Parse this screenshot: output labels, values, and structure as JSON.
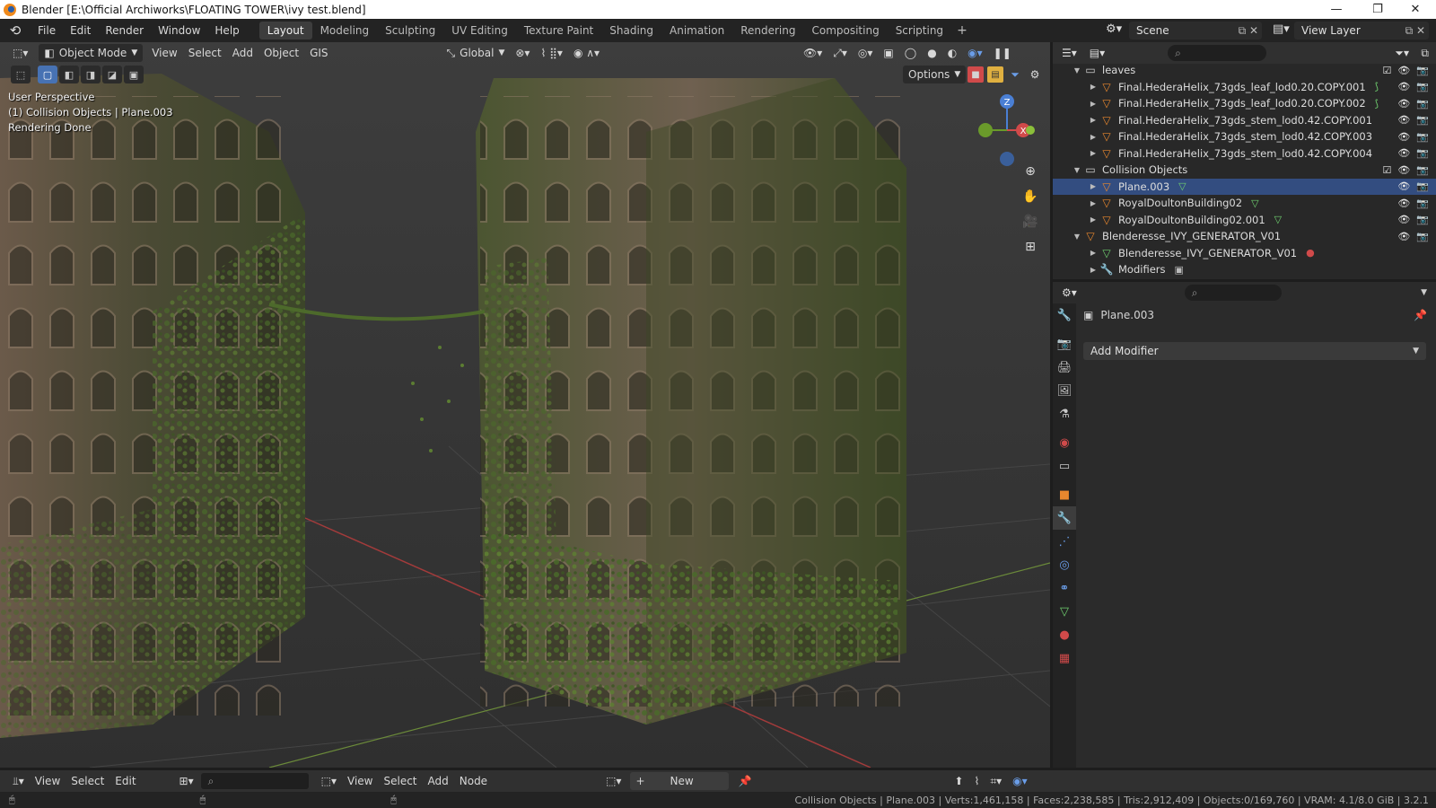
{
  "window": {
    "title": "Blender [E:\\Official Archiworks\\FLOATING TOWER\\ivy test.blend]",
    "controls": [
      "—",
      "❐",
      "✕"
    ]
  },
  "menus": [
    "File",
    "Edit",
    "Render",
    "Window",
    "Help"
  ],
  "workspaces": [
    {
      "label": "Layout",
      "active": true
    },
    {
      "label": "Modeling"
    },
    {
      "label": "Sculpting"
    },
    {
      "label": "UV Editing"
    },
    {
      "label": "Texture Paint"
    },
    {
      "label": "Shading"
    },
    {
      "label": "Animation"
    },
    {
      "label": "Rendering"
    },
    {
      "label": "Compositing"
    },
    {
      "label": "Scripting"
    }
  ],
  "scene": {
    "name": "Scene",
    "view_layer": "View Layer"
  },
  "viewport": {
    "mode": "Object Mode",
    "menus": [
      "View",
      "Select",
      "Add",
      "Object",
      "GIS"
    ],
    "transform_orientation": "Global",
    "options_label": "Options",
    "info_lines": [
      "User Perspective",
      "(1) Collision Objects | Plane.003",
      "Rendering Done"
    ],
    "gizmo_axes": {
      "z": "Z",
      "x": "X",
      "y": "Y"
    },
    "accent": "#4772b3"
  },
  "outliner": {
    "rows": [
      {
        "level": 0,
        "type": "collection",
        "label": "leaves",
        "expanded": true,
        "checkbox": true
      },
      {
        "level": 1,
        "type": "object",
        "label": "Final.HederaHelix_73gds_leaf_lod0.20.COPY.001",
        "tag": "curve"
      },
      {
        "level": 1,
        "type": "object",
        "label": "Final.HederaHelix_73gds_leaf_lod0.20.COPY.002",
        "tag": "curve"
      },
      {
        "level": 1,
        "type": "object",
        "label": "Final.HederaHelix_73gds_stem_lod0.42.COPY.001"
      },
      {
        "level": 1,
        "type": "object",
        "label": "Final.HederaHelix_73gds_stem_lod0.42.COPY.003"
      },
      {
        "level": 1,
        "type": "object",
        "label": "Final.HederaHelix_73gds_stem_lod0.42.COPY.004"
      },
      {
        "level": 0,
        "type": "collection",
        "label": "Collision Objects",
        "expanded": true,
        "checkbox": true
      },
      {
        "level": 1,
        "type": "object",
        "label": "Plane.003",
        "tag": "mesh"
      },
      {
        "level": 1,
        "type": "object",
        "label": "RoyalDoultonBuilding02",
        "tag": "mesh"
      },
      {
        "level": 1,
        "type": "object",
        "label": "RoyalDoultonBuilding02.001",
        "tag": "mesh"
      },
      {
        "level": 0,
        "type": "object",
        "label": "Blenderesse_IVY_GENERATOR_V01",
        "expanded": true
      },
      {
        "level": 1,
        "type": "mesh",
        "label": "Blenderesse_IVY_GENERATOR_V01",
        "tag": "material"
      },
      {
        "level": 1,
        "type": "modifier",
        "label": "Modifiers",
        "tag": "modifier"
      }
    ]
  },
  "properties": {
    "object_name": "Plane.003",
    "add_modifier_label": "Add Modifier",
    "tabs": [
      {
        "icon": "tool-icon",
        "glyph": "🔧",
        "color": "#c8c8c8"
      },
      {
        "icon": "render-icon",
        "glyph": "📷",
        "color": "#c8c8c8"
      },
      {
        "icon": "output-icon",
        "glyph": "🖨",
        "color": "#c8c8c8"
      },
      {
        "icon": "view-layer-icon",
        "glyph": "🖼",
        "color": "#c8c8c8"
      },
      {
        "icon": "scene-icon",
        "glyph": "⚗",
        "color": "#c8c8c8"
      },
      {
        "icon": "world-icon",
        "glyph": "◉",
        "color": "#d04a4a"
      },
      {
        "icon": "collection-icon",
        "glyph": "▭",
        "color": "#c8c8c8"
      },
      {
        "icon": "object-icon",
        "glyph": "■",
        "color": "#e8872e"
      },
      {
        "icon": "modifier-icon",
        "glyph": "🔧",
        "color": "#6a9de8",
        "active": true
      },
      {
        "icon": "particles-icon",
        "glyph": "⋰",
        "color": "#6a9de8"
      },
      {
        "icon": "physics-icon",
        "glyph": "◎",
        "color": "#6a9de8"
      },
      {
        "icon": "constraint-icon",
        "glyph": "⚭",
        "color": "#6a9de8"
      },
      {
        "icon": "data-icon",
        "glyph": "▽",
        "color": "#6fcf6f"
      },
      {
        "icon": "material-icon",
        "glyph": "●",
        "color": "#d04a4a"
      },
      {
        "icon": "texture-icon",
        "glyph": "▦",
        "color": "#d04a4a"
      }
    ]
  },
  "bottom_bar": {
    "left_menus": [
      "View",
      "Select",
      "Edit"
    ],
    "node_menus": [
      "View",
      "Select",
      "Add",
      "Node"
    ],
    "new_label": "New"
  },
  "status_bar": {
    "text": "Collision Objects | Plane.003 | Verts:1,461,158 | Faces:2,238,585 | Tris:2,912,409 | Objects:0/169,760 | VRAM: 4.1/8.0 GiB | 3.2.1"
  }
}
